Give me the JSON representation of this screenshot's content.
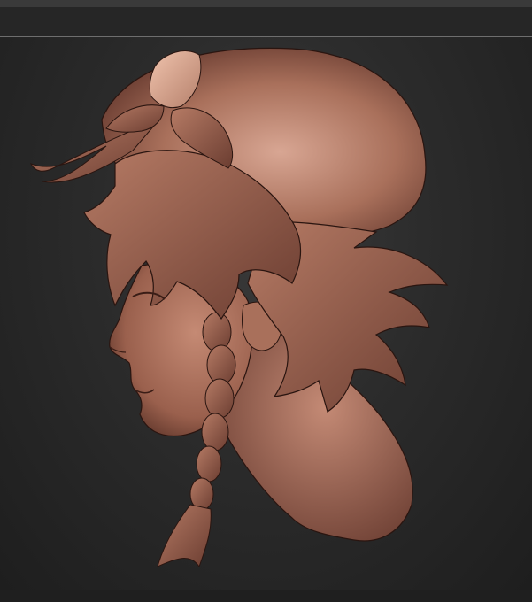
{
  "viewport": {
    "subject": "sculpt-model-head",
    "material": "clay",
    "colors": {
      "background": "#262626",
      "clay_base": "#a9705b",
      "clay_light": "#d4a08c",
      "clay_dark": "#5b3328",
      "outline": "#2a1510"
    }
  }
}
